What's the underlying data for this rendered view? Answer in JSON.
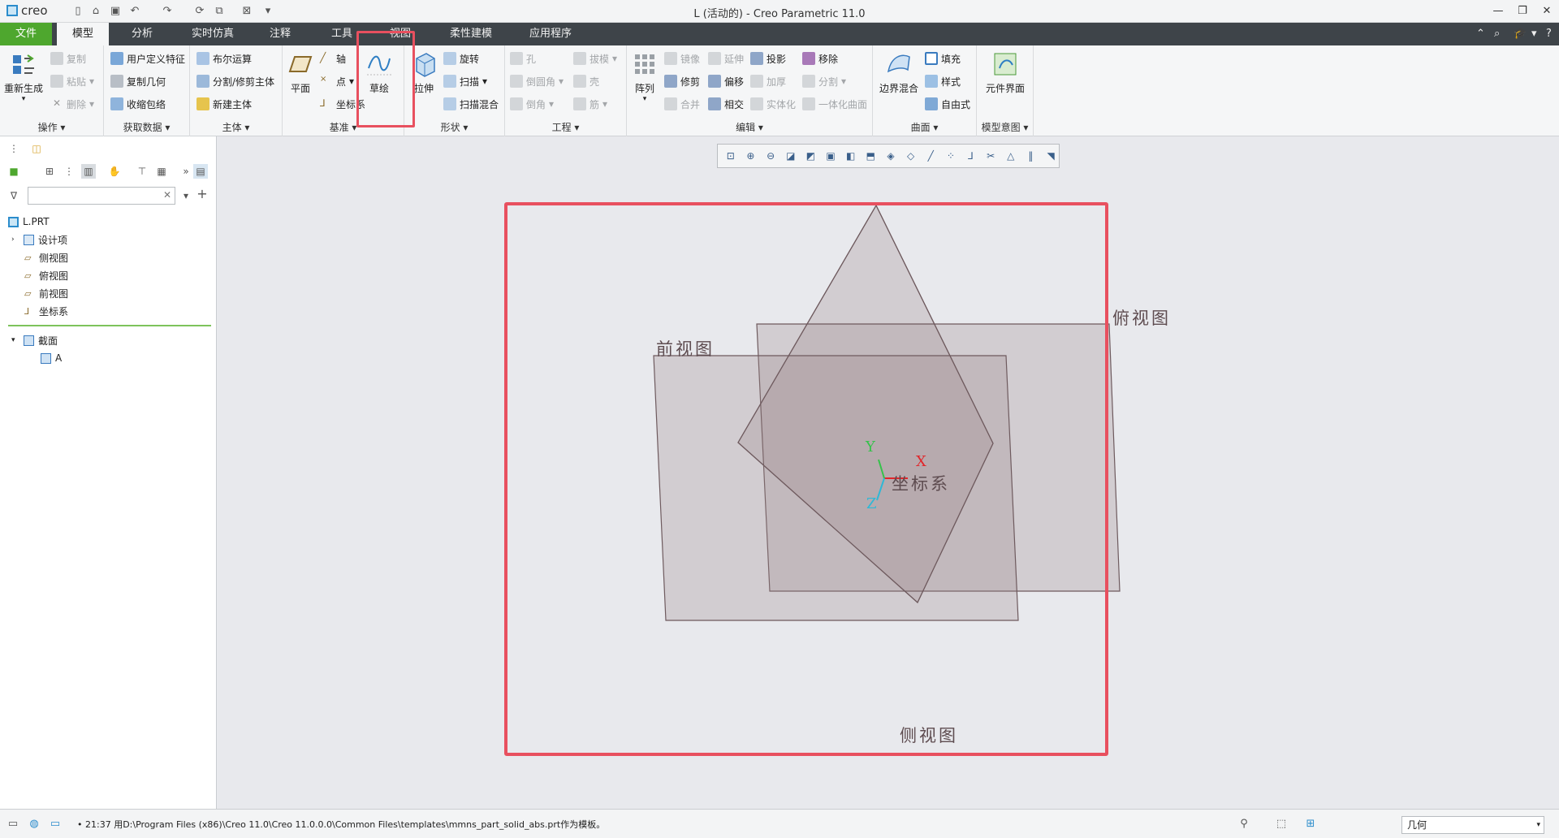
{
  "app": {
    "logo_text": "creo",
    "window_title": "L (活动的) - Creo Parametric 11.0"
  },
  "tabs": [
    {
      "label": "文件"
    },
    {
      "label": "模型"
    },
    {
      "label": "分析"
    },
    {
      "label": "实时仿真"
    },
    {
      "label": "注释"
    },
    {
      "label": "工具"
    },
    {
      "label": "视图"
    },
    {
      "label": "柔性建模"
    },
    {
      "label": "应用程序"
    }
  ],
  "ribbon": {
    "ops": {
      "regenerate": "重新生成",
      "copy": "复制",
      "paste": "粘贴",
      "delete": "删除",
      "group": "操作"
    },
    "getdata": {
      "udf": "用户定义特征",
      "copy_geom": "复制几何",
      "shrinkwrap": "收缩包络",
      "group": "获取数据"
    },
    "body": {
      "boolean": "布尔运算",
      "split": "分割/修剪主体",
      "new_body": "新建主体",
      "group": "主体"
    },
    "datum": {
      "plane": "平面",
      "axis": "轴",
      "point": "点",
      "csys": "坐标系",
      "sketch": "草绘",
      "group": "基准"
    },
    "shapes": {
      "extrude": "拉伸",
      "revolve": "旋转",
      "sweep": "扫描",
      "swept_blend": "扫描混合",
      "group": "形状"
    },
    "engineering": {
      "hole": "孔",
      "round": "倒圆角",
      "chamfer": "倒角",
      "draft": "拔模",
      "shell": "壳",
      "rib": "筋",
      "group": "工程"
    },
    "editing": {
      "pattern": "阵列",
      "mirror": "镜像",
      "extend": "延伸",
      "project": "投影",
      "remove": "移除",
      "trim": "修剪",
      "offset": "偏移",
      "thicken": "加厚",
      "split": "分割",
      "merge": "合并",
      "intersect": "相交",
      "solidify": "实体化",
      "unify": "一体化曲面",
      "group": "编辑"
    },
    "surfaces": {
      "boundary_blend": "边界混合",
      "fill": "填充",
      "style": "样式",
      "freestyle": "自由式",
      "group": "曲面"
    },
    "model_intent": {
      "component_interface": "元件界面",
      "group": "模型意图"
    }
  },
  "tree": {
    "search_placeholder": "",
    "items": [
      {
        "label": "L.PRT"
      },
      {
        "label": "设计项"
      },
      {
        "label": "侧视图"
      },
      {
        "label": "俯视图"
      },
      {
        "label": "前视图"
      },
      {
        "label": "坐标系"
      },
      {
        "label": "截面"
      },
      {
        "label": "A"
      }
    ]
  },
  "scene": {
    "labels": {
      "front": "前视图",
      "top": "俯视图",
      "right": "侧视图",
      "csys": "坐标系",
      "x": "X",
      "y": "Y",
      "z": "Z"
    },
    "colors": {
      "plane_fill": "#9c8489",
      "plane_stroke": "#6e5a5e",
      "highlight": "#e8505f",
      "x_axis": "#e0262b",
      "y_axis": "#34c24a",
      "z_axis": "#2fb8d6"
    }
  },
  "status": {
    "message": "21:37 用D:\\Program Files (x86)\\Creo 11.0\\Creo 11.0.0.0\\Common Files\\templates\\mmns_part_solid_abs.prt作为模板。",
    "filter_value": "几何"
  }
}
